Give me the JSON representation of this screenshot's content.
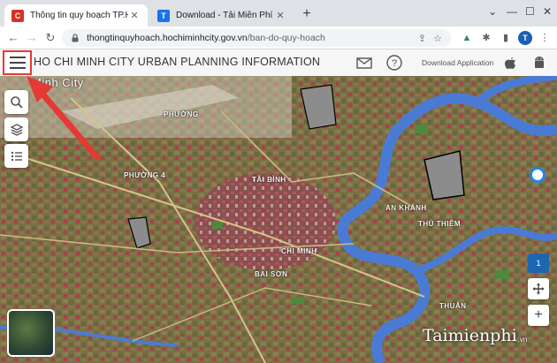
{
  "browser": {
    "tabs": [
      {
        "title": "Thông tin quy hoạch TP.HCM",
        "active": true,
        "favicon": "C"
      },
      {
        "title": "Download - Tải Miễn Phí VN - Ph",
        "active": false,
        "favicon": "T"
      }
    ],
    "url": {
      "host": "thongtinquyhoach.hochiminhcity.gov.vn",
      "path": "/ban-do-quy-hoach"
    },
    "profile_initial": "T"
  },
  "header": {
    "title": "HO CHI MINH CITY URBAN PLANNING INFORMATION",
    "download_label": "Download Application"
  },
  "map": {
    "labels": {
      "city": "Minh City",
      "phuong_top": "PHƯỜNG",
      "phuong_4": "PHƯỜNG 4",
      "tai_binh": "TÂI BÌNH",
      "an_khanh": "AN KHÁNH",
      "thu_thiem": "THỦ THIÊM",
      "chi_minh": "CHI MINH",
      "bai_son": "BAI SƠN",
      "thuan": "THUẬN"
    },
    "layer_count": "1"
  },
  "watermark": {
    "text": "Taimienphi",
    "suffix": ".vn"
  },
  "colors": {
    "highlight": "#e53935",
    "water": "#4a7bd4",
    "base": "#7a7046"
  }
}
